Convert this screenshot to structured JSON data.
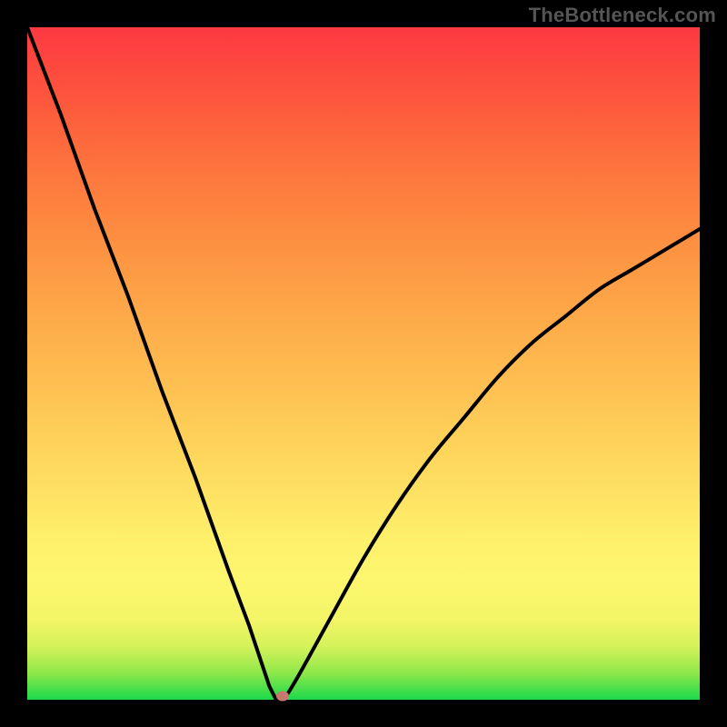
{
  "watermark": "TheBottleneck.com",
  "colors": {
    "curve": "#000000",
    "marker": "#c7786f",
    "frame": "#000000"
  },
  "chart_data": {
    "type": "line",
    "title": "",
    "xlabel": "",
    "ylabel": "",
    "xlim": [
      0,
      100
    ],
    "ylim": [
      0,
      100
    ],
    "grid": false,
    "legend": false,
    "description": "V-shaped bottleneck curve on a red→green vertical gradient. Minimum (best match) near x≈37 at y≈0. Left branch is steep and near-linear; right branch rises with decreasing slope (concave).",
    "series": [
      {
        "name": "bottleneck-curve",
        "x": [
          0,
          5,
          10,
          15,
          20,
          25,
          30,
          33,
          35,
          36,
          37,
          38,
          40,
          45,
          50,
          55,
          60,
          65,
          70,
          75,
          80,
          85,
          90,
          95,
          100
        ],
        "y": [
          100,
          87,
          73,
          60,
          46,
          33,
          19,
          11,
          5,
          2,
          0,
          0,
          3,
          12,
          21,
          29,
          36,
          42,
          48,
          53,
          57,
          61,
          64,
          67,
          70
        ]
      }
    ],
    "marker": {
      "x": 38,
      "y": 0.5,
      "label": "optimal-point"
    },
    "background_gradient": {
      "orientation": "vertical",
      "stops": [
        {
          "pos": 0.0,
          "color": "#1bd94c"
        },
        {
          "pos": 0.1,
          "color": "#d6f25a"
        },
        {
          "pos": 0.2,
          "color": "#fdf66f"
        },
        {
          "pos": 0.4,
          "color": "#fec152"
        },
        {
          "pos": 0.6,
          "color": "#fd9e45"
        },
        {
          "pos": 0.8,
          "color": "#fd773d"
        },
        {
          "pos": 1.0,
          "color": "#fd3942"
        }
      ]
    }
  }
}
